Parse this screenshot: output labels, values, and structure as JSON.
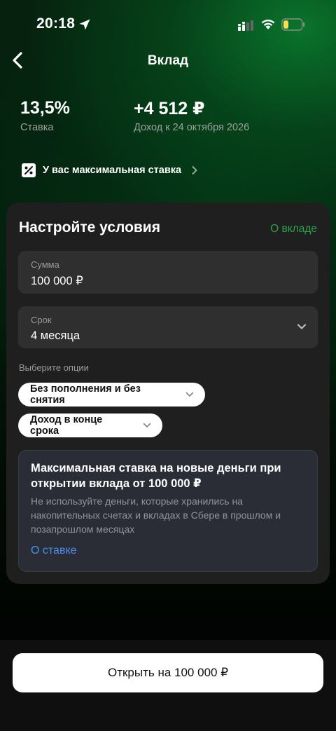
{
  "status_bar": {
    "time": "20:18"
  },
  "header": {
    "title": "Вклад"
  },
  "summary": {
    "rate_value": "13,5%",
    "rate_label": "Ставка",
    "income_value": "+4 512 ₽",
    "income_label": "Доход к 24 октября 2026"
  },
  "promo": {
    "text": "У вас максимальная ставка"
  },
  "card": {
    "title": "Настройте условия",
    "about_link": "О вкладе",
    "sum": {
      "label": "Сумма",
      "value": "100 000 ₽"
    },
    "term": {
      "label": "Срок",
      "value": "4 месяца"
    },
    "options_label": "Выберите опции",
    "options": [
      {
        "label": "Без пополнения и без снятия"
      },
      {
        "label": "Доход в конце срока"
      }
    ],
    "info": {
      "title": "Максимальная ставка на новые деньги при открытии вклада от 100 000 ₽",
      "text": "Не используйте деньги, которые хранились на накопительных счетах и вкладах в Сбере в прошлом и позапрошлом месяцах",
      "link": "О ставке"
    }
  },
  "footer": {
    "open_button": "Открыть на 100 000 ₽"
  },
  "colors": {
    "accent_green": "#2ca24c",
    "link_blue": "#4a8ef0",
    "battery_yellow": "#f4e04d"
  }
}
